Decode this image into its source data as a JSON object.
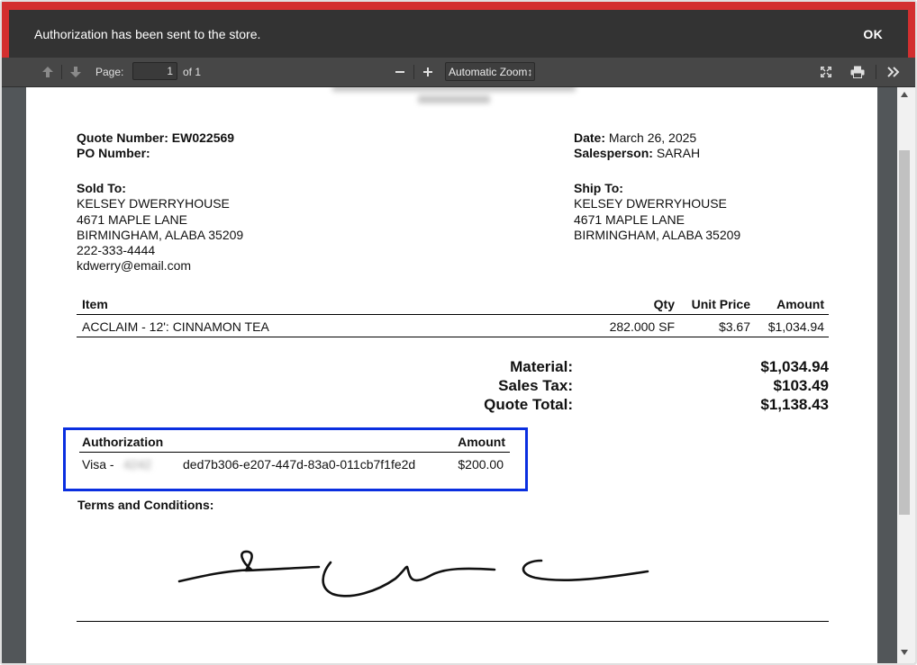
{
  "notification": {
    "text": "Authorization has been sent to the store.",
    "ok_label": "OK"
  },
  "toolbar": {
    "page_label": "Page:",
    "page_value": "1",
    "page_of": "of 1",
    "zoom_value": "Automatic Zoom↕"
  },
  "header_blur": {
    "line1": "",
    "line2": ""
  },
  "quote": {
    "number_label": "Quote Number:",
    "number_value": "EW022569",
    "po_label": "PO Number:",
    "date_label": "Date:",
    "date_value": "March 26, 2025",
    "salesperson_label": "Salesperson:",
    "salesperson_value": "SARAH"
  },
  "sold_to": {
    "label": "Sold To:",
    "name": "KELSEY DWERRYHOUSE",
    "address": "4671 MAPLE LANE",
    "city": "BIRMINGHAM, ALABA 35209",
    "phone": "222-333-4444",
    "email": "kdwerry@email.com"
  },
  "ship_to": {
    "label": "Ship To:",
    "name": "KELSEY DWERRYHOUSE",
    "address": "4671 MAPLE LANE",
    "city": "BIRMINGHAM, ALABA 35209"
  },
  "items_table": {
    "headers": {
      "item": "Item",
      "qty": "Qty",
      "unit_price": "Unit Price",
      "amount": "Amount"
    },
    "rows": [
      {
        "item": "ACCLAIM - 12': CINNAMON TEA",
        "qty": "282.000 SF",
        "unit_price": "$3.67",
        "amount": "$1,034.94"
      }
    ]
  },
  "totals": {
    "material_label": "Material:",
    "material_value": "$1,034.94",
    "tax_label": "Sales Tax:",
    "tax_value": "$103.49",
    "total_label": "Quote Total:",
    "total_value": "$1,138.43"
  },
  "authorization": {
    "header_auth": "Authorization",
    "header_amount": "Amount",
    "card_prefix": "Visa -",
    "card_masked": "4242",
    "transaction_id": "ded7b306-e207-447d-83a0-011cb7f1fe2d",
    "amount": "$200.00"
  },
  "terms_label": "Terms and Conditions:",
  "colors": {
    "accent_red": "#d32f2f",
    "highlight_blue": "#0a2fe0",
    "toolbar_bg": "#474747",
    "viewer_bg": "#525659"
  }
}
